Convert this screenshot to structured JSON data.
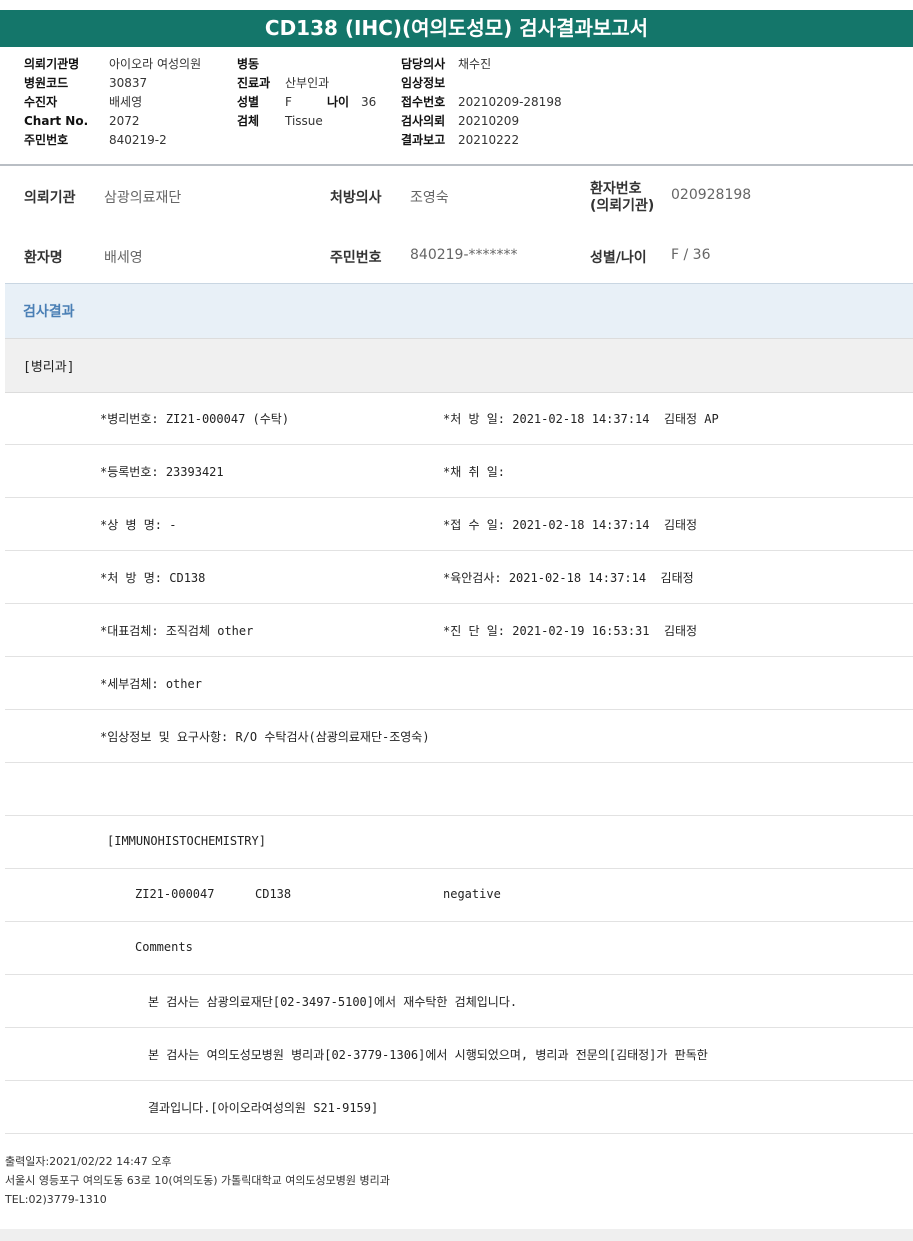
{
  "title": "CD138 (IHC)(여의도성모) 검사결과보고서",
  "header": {
    "col1": [
      {
        "label": "의뢰기관명",
        "value": "아이오라 여성의원"
      },
      {
        "label": "병원코드",
        "value": "30837"
      },
      {
        "label": "수진자",
        "value": "배세영"
      },
      {
        "label": "Chart No.",
        "value": "2072"
      },
      {
        "label": "주민번호",
        "value": "840219-2"
      }
    ],
    "col2": [
      {
        "label": "병동",
        "value": ""
      },
      {
        "label": "진료과",
        "value": "산부인과"
      },
      {
        "label": "성별",
        "value": "F",
        "label2": "나이",
        "value2": "36"
      },
      {
        "label": "검체",
        "value": "Tissue"
      }
    ],
    "col3": [
      {
        "label": "담당의사",
        "value": "채수진"
      },
      {
        "label": "임상정보",
        "value": ""
      },
      {
        "label": "접수번호",
        "value": "20210209-28198"
      },
      {
        "label": "검사의뢰",
        "value": "20210209"
      },
      {
        "label": "결과보고",
        "value": "20210222"
      }
    ]
  },
  "info": {
    "institution_label": "의뢰기관",
    "institution": "삼광의료재단",
    "doctor_label": "처방의사",
    "doctor": "조영숙",
    "patient_no_label": "환자번호",
    "patient_no_label2": "(의뢰기관)",
    "patient_no": "020928198",
    "patient_name_label": "환자명",
    "patient_name": "배세영",
    "rrn_label": "주민번호",
    "rrn": "840219-*******",
    "sex_age_label": "성별/나이",
    "sex_age": "F / 36"
  },
  "result_section": "검사결과",
  "department": "[병리과]",
  "rows": [
    {
      "left": "*병리번호: ZI21-000047 (수탁)",
      "right": "*처 방 일: 2021-02-18 14:37:14  김태정 AP"
    },
    {
      "left": "*등록번호: 23393421",
      "right": "*채 취 일:"
    },
    {
      "left": "*상 병 명: -",
      "right": "*접 수 일: 2021-02-18 14:37:14  김태정"
    },
    {
      "left": "*처 방 명: CD138",
      "right": "*육안검사: 2021-02-18 14:37:14  김태정"
    },
    {
      "left": "*대표검체: 조직검체 other",
      "right": "*진 단 일: 2021-02-19 16:53:31  김태정"
    },
    {
      "left": "*세부검체: other",
      "right": ""
    },
    {
      "left": "*임상정보 및 요구사항: R/O 수탁검사(삼광의료재단-조영숙)",
      "right": ""
    }
  ],
  "ihc": {
    "heading": "[IMMUNOHISTOCHEMISTRY]",
    "case_no": "ZI21-000047",
    "marker": "CD138",
    "result": "negative",
    "comments_label": "Comments",
    "comment1": "본 검사는 삼광의료재단[02-3497-5100]에서 재수탁한 검체입니다.",
    "comment2": "본 검사는 여의도성모병원 병리과[02-3779-1306]에서 시행되었으며, 병리과 전문의[김태정]가 판독한",
    "comment3": "결과입니다.[아이오라여성의원 S21-9159]"
  },
  "footer": {
    "printed": "출력일자:2021/02/22 14:47 오후",
    "address": "서울시 영등포구 여의도동 63로 10(여의도동) 가톨릭대학교 여의도성모병원 병리과",
    "tel": "TEL:02)3779-1310"
  },
  "colors": {
    "title_bar": "#14766a",
    "result_label": "#4a7fb5"
  }
}
